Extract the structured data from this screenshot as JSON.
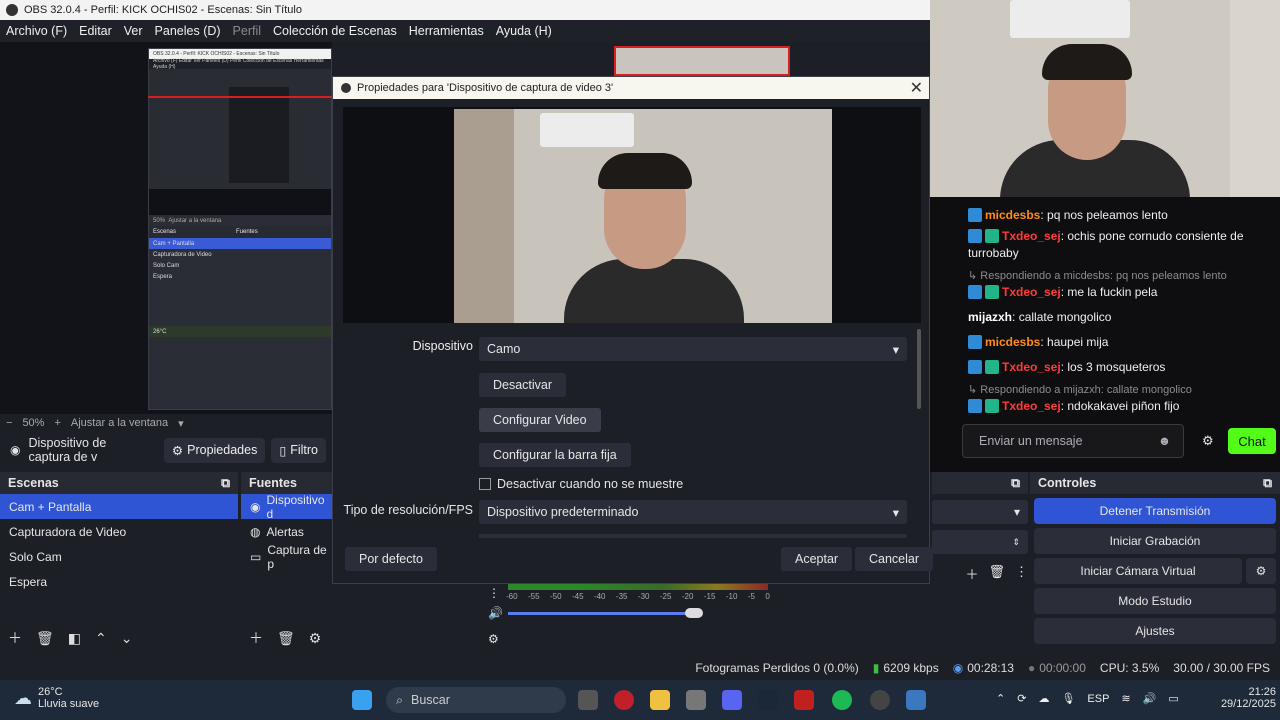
{
  "titlebar": {
    "title": "OBS 32.0.4 - Perfil: KICK OCHIS02 - Escenas: Sin Título"
  },
  "menu": [
    "Archivo (F)",
    "Editar",
    "Ver",
    "Paneles (D)",
    "Perfil",
    "Colección de Escenas",
    "Herramientas",
    "Ayuda (H)"
  ],
  "nested": {
    "title": "OBS 32.0.4 - Perfil: KICK OCHIS02 - Escenas: Sin Título",
    "menu": "Archivo (F)   Editar   Ver   Paneles (D)   Perfil   Colección de Escenas   Herramientas   Ayuda (H)",
    "scenes": [
      "Cam + Pantalla",
      "Capturadora de Video",
      "Solo Cam",
      "Espera"
    ],
    "scenes_label": "Escenas",
    "sources_label": "Fuentes",
    "zoom": "50%",
    "fit": "Ajustar a la ventana",
    "weather": "26°C"
  },
  "zoombar": {
    "minus": "−",
    "zoom": "50%",
    "plus": "+",
    "fit": "Ajustar a la ventana"
  },
  "source_toolbar": {
    "source_name": "Dispositivo de captura de v",
    "properties": "Propiedades",
    "filters": "Filtro"
  },
  "dialog": {
    "title": "Propiedades para 'Dispositivo de captura de video 3'",
    "device_label": "Dispositivo",
    "device_value": "Camo",
    "deactivate": "Desactivar",
    "configure_video": "Configurar Video",
    "configure_crossbar": "Configurar la barra fija",
    "deactivate_hidden": "Desactivar cuando no se muestre",
    "resolution_label": "Tipo de resolución/FPS",
    "resolution_value": "Dispositivo predeterminado",
    "defaults": "Por defecto",
    "accept": "Aceptar",
    "cancel": "Cancelar"
  },
  "scenes": {
    "title": "Escenas",
    "items": [
      "Cam + Pantalla",
      "Capturadora de Video",
      "Solo Cam",
      "Espera"
    ],
    "selected": 0
  },
  "sources": {
    "title": "Fuentes",
    "items": [
      "Dispositivo d",
      "Alertas",
      "Captura de p"
    ],
    "selected": 0
  },
  "mixer": {
    "ticks": [
      "-60",
      "-55",
      "-50",
      "-45",
      "-40",
      "-35",
      "-30",
      "-25",
      "-20",
      "-15",
      "-10",
      "-5",
      "0"
    ]
  },
  "controls": {
    "title": "Controles",
    "buttons": [
      "Detener Transmisión",
      "Iniciar Grabación",
      "Iniciar Cámara Virtual",
      "Modo Estudio",
      "Ajustes"
    ]
  },
  "statusbar": {
    "dropped": "Fotogramas Perdidos 0 (0.0%)",
    "bitrate": "6209 kbps",
    "live_time": "00:28:13",
    "rec_time": "00:00:00",
    "cpu": "CPU: 3.5%",
    "fps": "30.00 / 30.00 FPS"
  },
  "chat": {
    "messages": [
      {
        "user": "micdesbs",
        "text": "pq nos peleamos lento",
        "color": "#ff8c1a",
        "badges": 1
      },
      {
        "user": "Txdeo_sej",
        "text": "ochis pone cornudo consiente de turrobaby",
        "color": "#ff3b3b",
        "badges": 2
      },
      {
        "reply": "Respondiendo a micdesbs: pq nos peleamos lento"
      },
      {
        "user": "Txdeo_sej",
        "text": "me la fuckin pela",
        "color": "#ff3b3b",
        "badges": 2
      },
      {
        "user": "mijazxh",
        "text": "callate mongolico",
        "color": "#ffffff",
        "badges": 0
      },
      {
        "user": "micdesbs",
        "text": "haupei mija",
        "color": "#ff8c1a",
        "badges": 1
      },
      {
        "user": "Txdeo_sej",
        "text": "los 3 mosqueteros",
        "color": "#ff3b3b",
        "badges": 2
      },
      {
        "reply": "Respondiendo a mijazxh: callate mongolico"
      },
      {
        "user": "Txdeo_sej",
        "text": "ndokakavei piñon fijo",
        "color": "#ff3b3b",
        "badges": 2
      }
    ],
    "input_placeholder": "Enviar un mensaje",
    "send": "Chat"
  },
  "taskbar": {
    "weather_temp": "26°C",
    "weather_desc": "Lluvia suave",
    "search": "Buscar",
    "lang": "ESP",
    "time": "21:26",
    "date": "29/12/2025"
  }
}
